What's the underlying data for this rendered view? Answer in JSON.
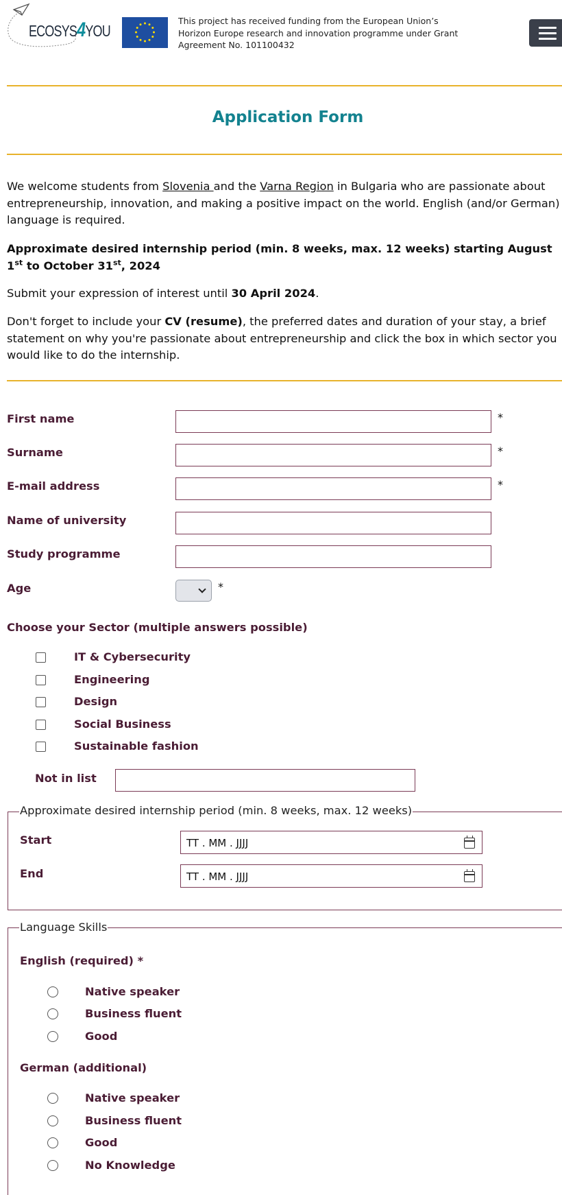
{
  "header": {
    "logo": {
      "prefix": "ECOSYS",
      "four": "4",
      "suffix": "YOU"
    },
    "eu_flag_icon": "eu-flag",
    "funding_text": "This project has received funding from the European Union’s Horizon Europe research and innovation programme under Grant Agreement No. 101100432",
    "menu_icon": "hamburger-menu"
  },
  "page_title": "Application Form",
  "intro": {
    "p1_a": "We welcome students from ",
    "p1_link1": "Slovenia ",
    "p1_b": "and the ",
    "p1_link2": "Varna Region",
    "p1_c": " in Bulgaria who are passionate about entrepreneurship, innovation, and making a positive impact on the world. English (and/or German) language is required.",
    "p2_a": "Approximate desired internship period (min. 8 weeks, max. 12 weeks) starting August 1",
    "p2_sup1": "st",
    "p2_b": " to October 31",
    "p2_sup2": "st",
    "p2_c": ", 2024",
    "p3_a": "Submit your expression of interest until ",
    "p3_bold": "30 April 2024",
    "p3_c": ".",
    "p4_a": "Don't forget to include your ",
    "p4_bold": "CV (resume)",
    "p4_c": ", the preferred dates and duration of your stay, a brief statement on why you're passionate about entrepreneurship and click the box in which sector you would like to do the internship."
  },
  "form": {
    "first_name": {
      "label": "First name",
      "value": "",
      "required_mark": "*"
    },
    "surname": {
      "label": "Surname",
      "value": "",
      "required_mark": "*"
    },
    "email": {
      "label": "E-mail address",
      "value": "",
      "required_mark": "*"
    },
    "university": {
      "label": "Name of university",
      "value": ""
    },
    "study_programme": {
      "label": "Study programme",
      "value": ""
    },
    "age": {
      "label": "Age",
      "value": "",
      "required_mark": "*"
    },
    "sector": {
      "heading": "Choose your Sector (multiple answers possible)",
      "options": [
        "IT & Cybersecurity",
        "Engineering",
        "Design",
        "Social Business",
        "Sustainable fashion"
      ],
      "not_in_list_label": "Not in list",
      "not_in_list_value": ""
    },
    "period": {
      "legend": "Approximate desired internship period (min. 8 weeks, max. 12 weeks)",
      "start_label": "Start",
      "start_placeholder": "TT . MM . JJJJ",
      "end_label": "End",
      "end_placeholder": "TT . MM . JJJJ"
    },
    "languages": {
      "legend": "Language Skills",
      "english_heading": "English (required) *",
      "english_options": [
        "Native speaker",
        "Business fluent",
        "Good"
      ],
      "german_heading": "German (additional)",
      "german_options": [
        "Native speaker",
        "Business fluent",
        "Good",
        "No Knowledge"
      ]
    }
  },
  "colors": {
    "accent": "#13828f",
    "gold": "#e8b22b",
    "label": "#4a1c34",
    "border": "#7a3a55"
  }
}
